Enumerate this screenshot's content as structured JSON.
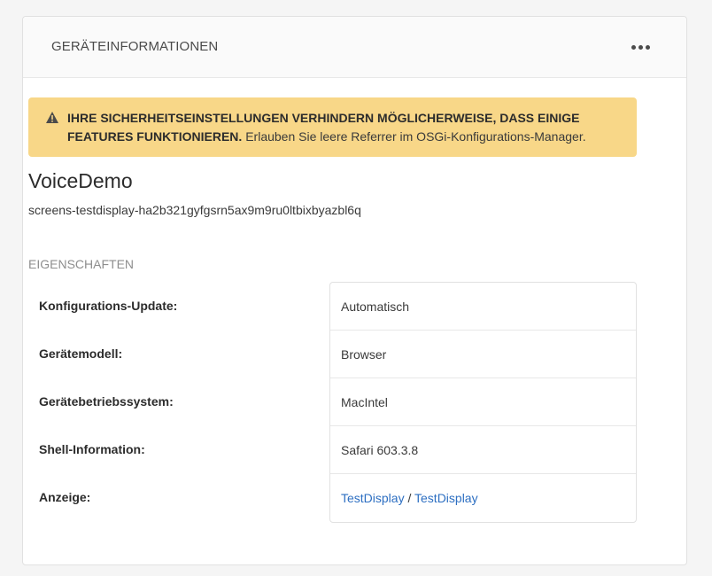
{
  "card": {
    "title": "GERÄTEINFORMATIONEN",
    "more_icon": "ellipsis-icon"
  },
  "alert": {
    "icon": "warning-icon",
    "strong_text": "IHRE SICHERHEITSEINSTELLUNGEN VERHINDERN MÖGLICHERWEISE, DASS EINIGE FEATURES FUNKTIONIEREN.",
    "text": "Erlauben Sie leere Referrer im OSGi-Konfigurations-Manager.",
    "background": "#f8d788"
  },
  "device": {
    "name": "VoiceDemo",
    "id": "screens-testdisplay-ha2b321gyfgsrn5ax9m9ru0ltbixbyazbl6q"
  },
  "properties": {
    "section_label": "EIGENSCHAFTEN",
    "rows": [
      {
        "label": "Konfigurations-Update:",
        "value": "Automatisch"
      },
      {
        "label": "Gerätemodell:",
        "value": "Browser"
      },
      {
        "label": "Gerätebetriebssystem:",
        "value": "MacIntel"
      },
      {
        "label": "Shell-Information:",
        "value": "Safari 603.3.8"
      },
      {
        "label": "Anzeige:",
        "link1": "TestDisplay",
        "separator": "/",
        "link2": "TestDisplay"
      }
    ]
  },
  "colors": {
    "link": "#2d6fc2"
  }
}
